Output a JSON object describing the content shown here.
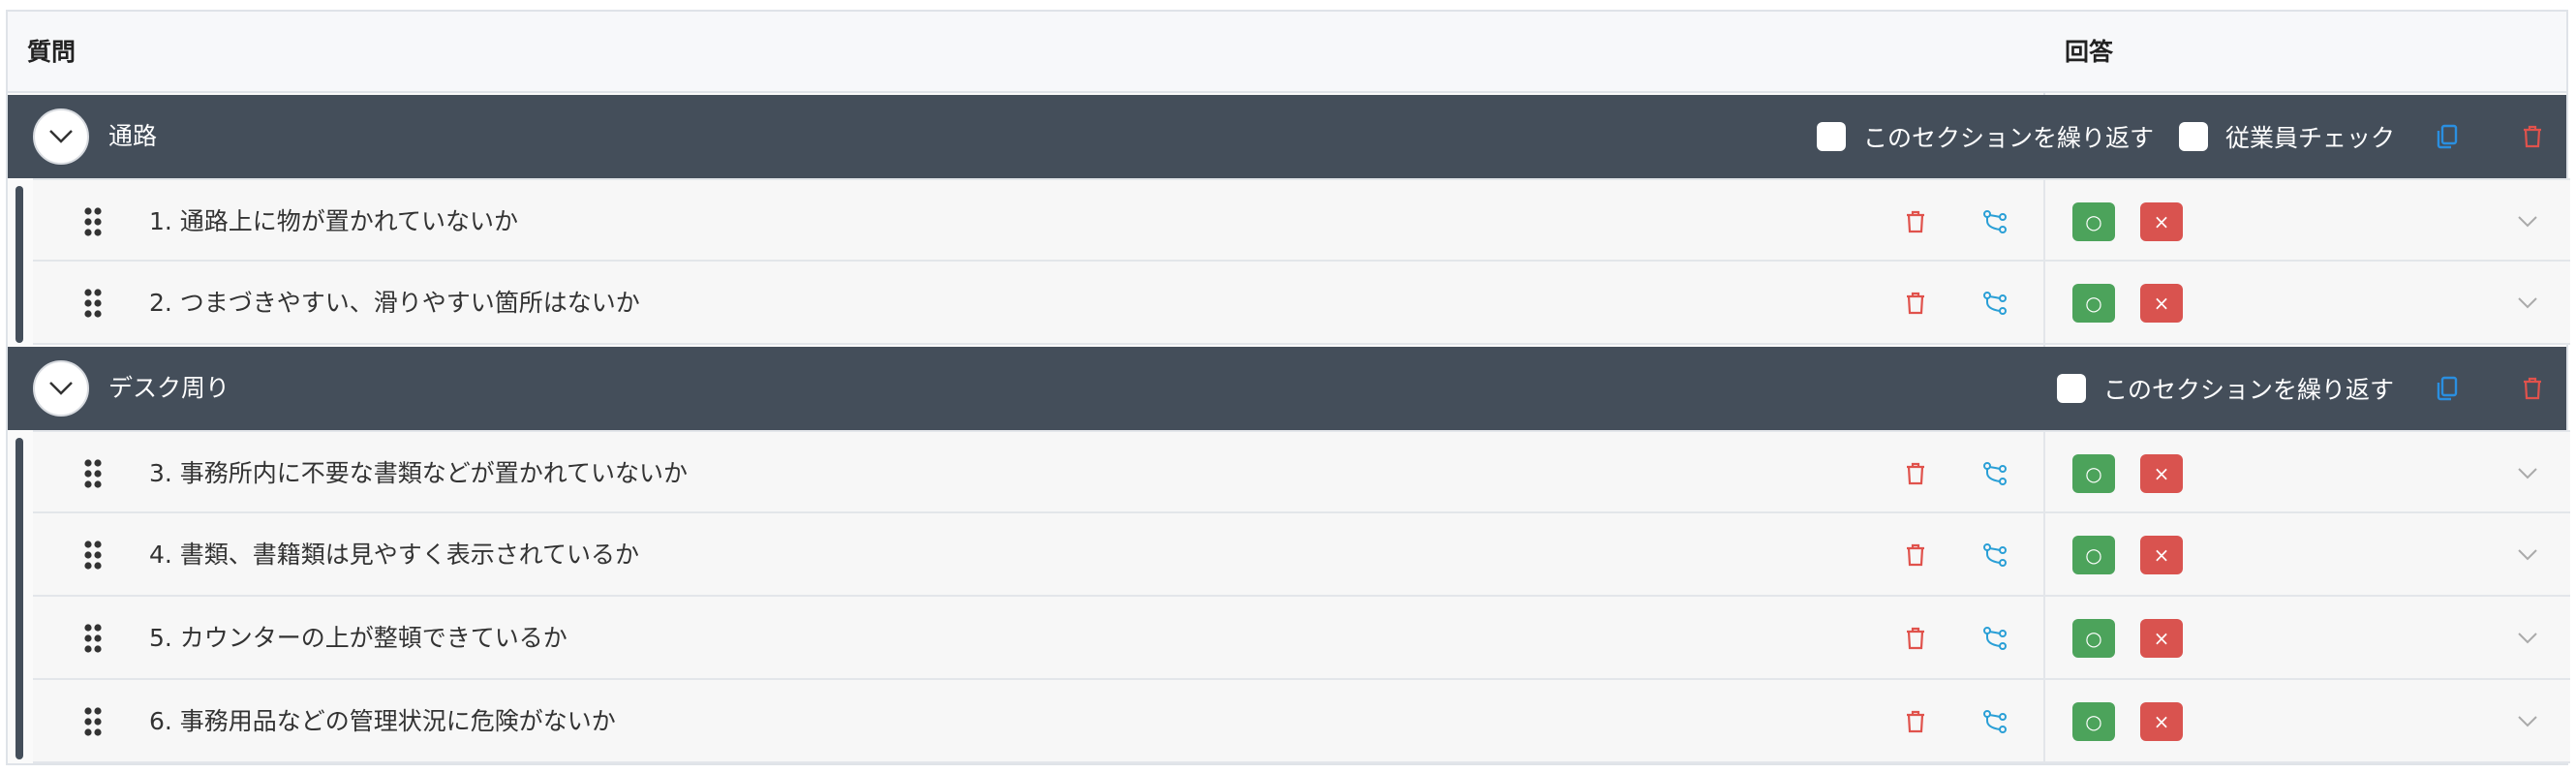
{
  "header": {
    "question": "質問",
    "answer": "回答"
  },
  "sections": [
    {
      "title": "通路",
      "repeat_label": "このセクションを繰り返す",
      "employee_check_label": "従業員チェック",
      "questions": [
        "1. 通路上に物が置かれていないか",
        "2. つまづきやすい、滑りやすい箇所はないか"
      ]
    },
    {
      "title": "デスク周り",
      "repeat_label": "このセクションを繰り返す",
      "questions": [
        "3. 事務所内に不要な書類などが置かれていないか",
        "4. 書類、書籍類は見やすく表示されているか",
        "5. カウンターの上が整頓できているか",
        "6. 事務用品などの管理状況に危険がないか"
      ]
    }
  ],
  "answer_buttons": {
    "ok_symbol": "○",
    "ng_symbol": "×"
  },
  "colors": {
    "section_bg": "#444e5a",
    "ok": "#4ca35b",
    "ng": "#d9534f",
    "delete_icon": "#e0524c",
    "branch_icon": "#2a9fd6",
    "copy_icon": "#2a8fe0"
  },
  "icons": [
    "chevron-down-icon",
    "drag-handle-icon",
    "trash-icon",
    "branch-icon",
    "copy-icon"
  ]
}
